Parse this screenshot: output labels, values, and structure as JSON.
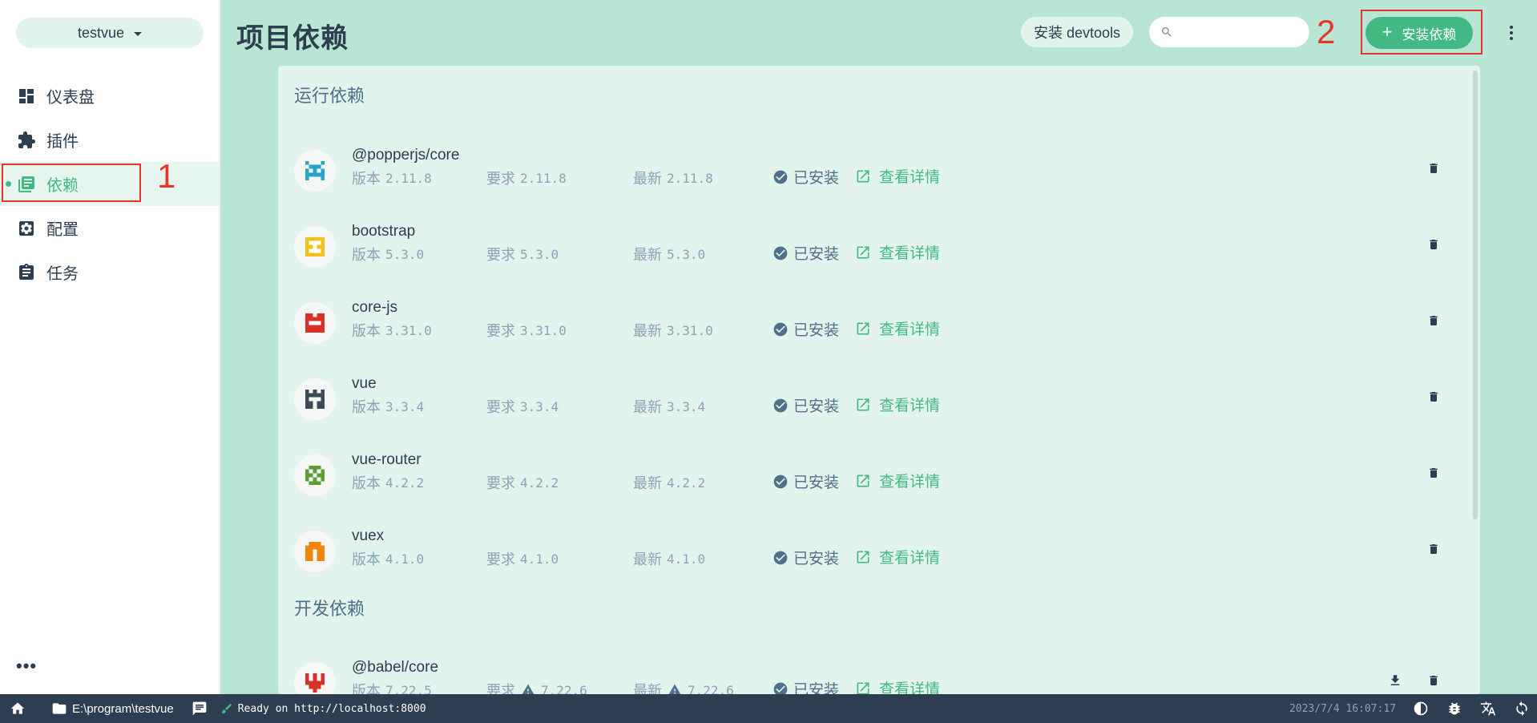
{
  "sidebar": {
    "project": "testvue",
    "items": [
      {
        "label": "仪表盘",
        "icon": "dashboard-icon"
      },
      {
        "label": "插件",
        "icon": "puzzle-icon"
      },
      {
        "label": "依赖",
        "icon": "library-icon"
      },
      {
        "label": "配置",
        "icon": "settings-icon"
      },
      {
        "label": "任务",
        "icon": "clipboard-icon"
      }
    ],
    "more_label": "•••"
  },
  "annotations": {
    "n1": "1",
    "n2": "2"
  },
  "header": {
    "title": "项目依赖",
    "devtools_label": "安装 devtools",
    "search_placeholder": "",
    "install_label": "安装依赖"
  },
  "sections": {
    "runtime_title": "运行依赖",
    "dev_title": "开发依赖"
  },
  "dependencies": [
    {
      "name": "@popperjs/core",
      "version": "2.11.8",
      "required": "2.11.8",
      "latest": "2.11.8",
      "color": "#26a6c6"
    },
    {
      "name": "bootstrap",
      "version": "5.3.0",
      "required": "5.3.0",
      "latest": "5.3.0",
      "color": "#f2c21a"
    },
    {
      "name": "core-js",
      "version": "3.31.0",
      "required": "3.31.0",
      "latest": "3.31.0",
      "color": "#d9302b"
    },
    {
      "name": "vue",
      "version": "3.3.4",
      "required": "3.3.4",
      "latest": "3.3.4",
      "color": "#3d4a58"
    },
    {
      "name": "vue-router",
      "version": "4.2.2",
      "required": "4.2.2",
      "latest": "4.2.2",
      "color": "#5d9d31"
    },
    {
      "name": "vuex",
      "version": "4.1.0",
      "required": "4.1.0",
      "latest": "4.1.0",
      "color": "#f0850c"
    },
    {
      "name": "@babel/core",
      "version": "7.22.5",
      "required": "7.22.6",
      "latest": "7.22.6",
      "color": "#d9302b"
    }
  ],
  "labels": {
    "version": "版本",
    "required": "要求",
    "latest": "最新",
    "installed": "已安装",
    "details": "查看详情"
  },
  "statusbar": {
    "path": "E:\\program\\testvue",
    "ready": "Ready on http://localhost:8000",
    "time": "2023/7/4 16:07:17"
  }
}
